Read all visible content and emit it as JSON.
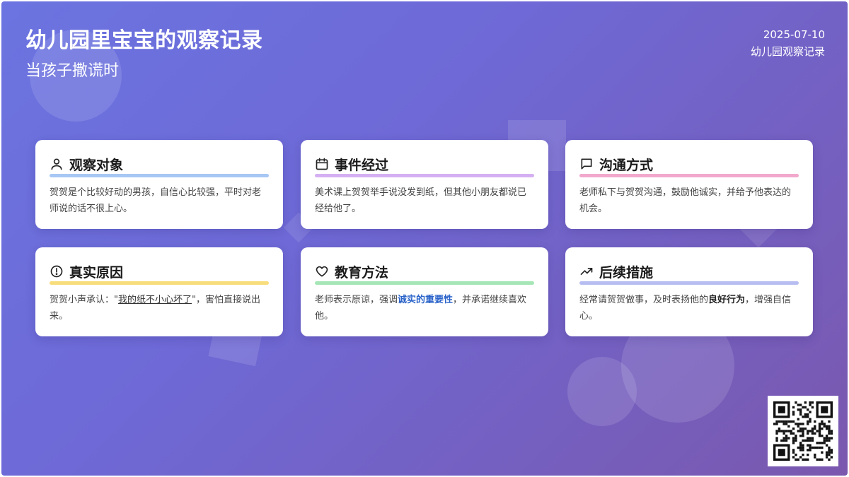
{
  "header": {
    "title": "幼儿园里宝宝的观察记录",
    "subtitle": "当孩子撒谎时",
    "date": "2025-07-10",
    "tag": "幼儿园观察记录"
  },
  "colors": {
    "gradient_start": "#6b74e0",
    "gradient_end": "#7a58ae",
    "bar_observe": "#a7c7f5",
    "bar_event": "#d4b0f2",
    "bar_comm": "#f1a8cc",
    "bar_reason": "#f8dd7c",
    "bar_method": "#a6e6b6",
    "bar_follow": "#b7bdf0",
    "keyword": "#2a63c9"
  },
  "cards": [
    {
      "icon": "person-icon",
      "title": "观察对象",
      "text": "贺贺是个比较好动的男孩，自信心比较强，平时对老师说的话不很上心。"
    },
    {
      "icon": "calendar-icon",
      "title": "事件经过",
      "text": "美术课上贺贺举手说没发到纸，但其他小朋友都说已经给他了。"
    },
    {
      "icon": "chat-bubble-icon",
      "title": "沟通方式",
      "text": "老师私下与贺贺沟通，鼓励他诚实，并给予他表达的机会。"
    },
    {
      "icon": "alert-circle-icon",
      "title": "真实原因",
      "text_pre": "贺贺小声承认：\"",
      "text_quote": "我的纸不小心坏了",
      "text_post": "\"，害怕直接说出来。"
    },
    {
      "icon": "heart-icon",
      "title": "教育方法",
      "text_pre": "老师表示原谅，强调",
      "text_key": "诚实的重要性",
      "text_post": "，并承诺继续喜欢他。"
    },
    {
      "icon": "trending-up-icon",
      "title": "后续措施",
      "text_pre": "经常请贺贺做事，及时表扬他的",
      "text_key": "良好行为",
      "text_post": "，增强自信心。"
    }
  ],
  "qr": {
    "icon": "qr-code-icon"
  }
}
